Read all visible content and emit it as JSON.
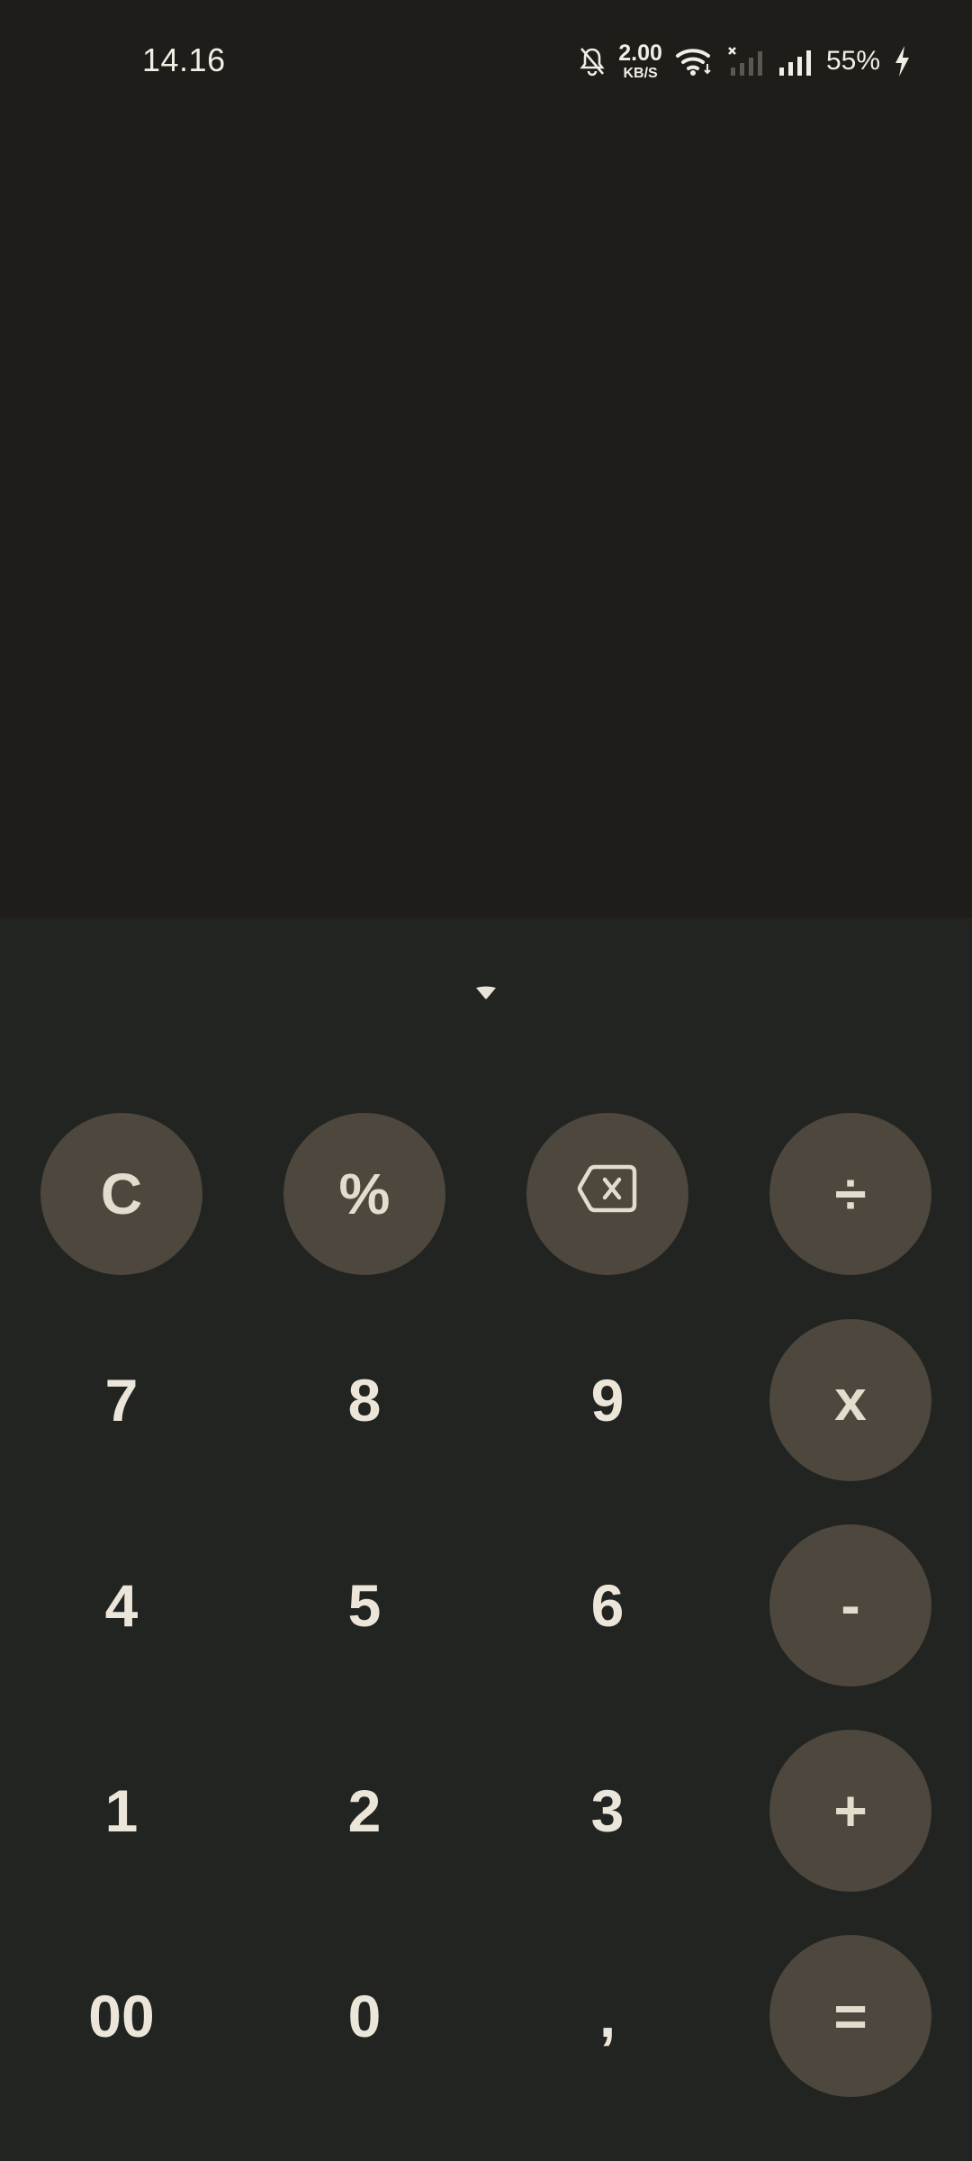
{
  "status_bar": {
    "time": "14.16",
    "net_speed_value": "2.00",
    "net_speed_unit": "KB/S",
    "battery_percent": "55%",
    "icons": [
      "bell-off-icon",
      "wifi-icon",
      "signal-no-service-icon",
      "signal-icon",
      "charging-icon"
    ]
  },
  "display": {
    "expression": "",
    "result": ""
  },
  "keypad": {
    "toggle_icon": "chevron-down-icon",
    "clear_label": "C",
    "percent_label": "%",
    "backspace_icon": "backspace-icon",
    "divide_label": "÷",
    "multiply_label": "x",
    "subtract_label": "-",
    "add_label": "+",
    "equals_label": "=",
    "digits": {
      "seven": "7",
      "eight": "8",
      "nine": "9",
      "four": "4",
      "five": "5",
      "six": "6",
      "one": "1",
      "two": "2",
      "three": "3",
      "double_zero": "00",
      "zero": "0",
      "comma": ","
    }
  },
  "colors": {
    "display_bg": "#1e1d19",
    "keypad_bg": "#212420",
    "operator_key_bg": "#4d473d",
    "key_text": "#ece6da"
  }
}
